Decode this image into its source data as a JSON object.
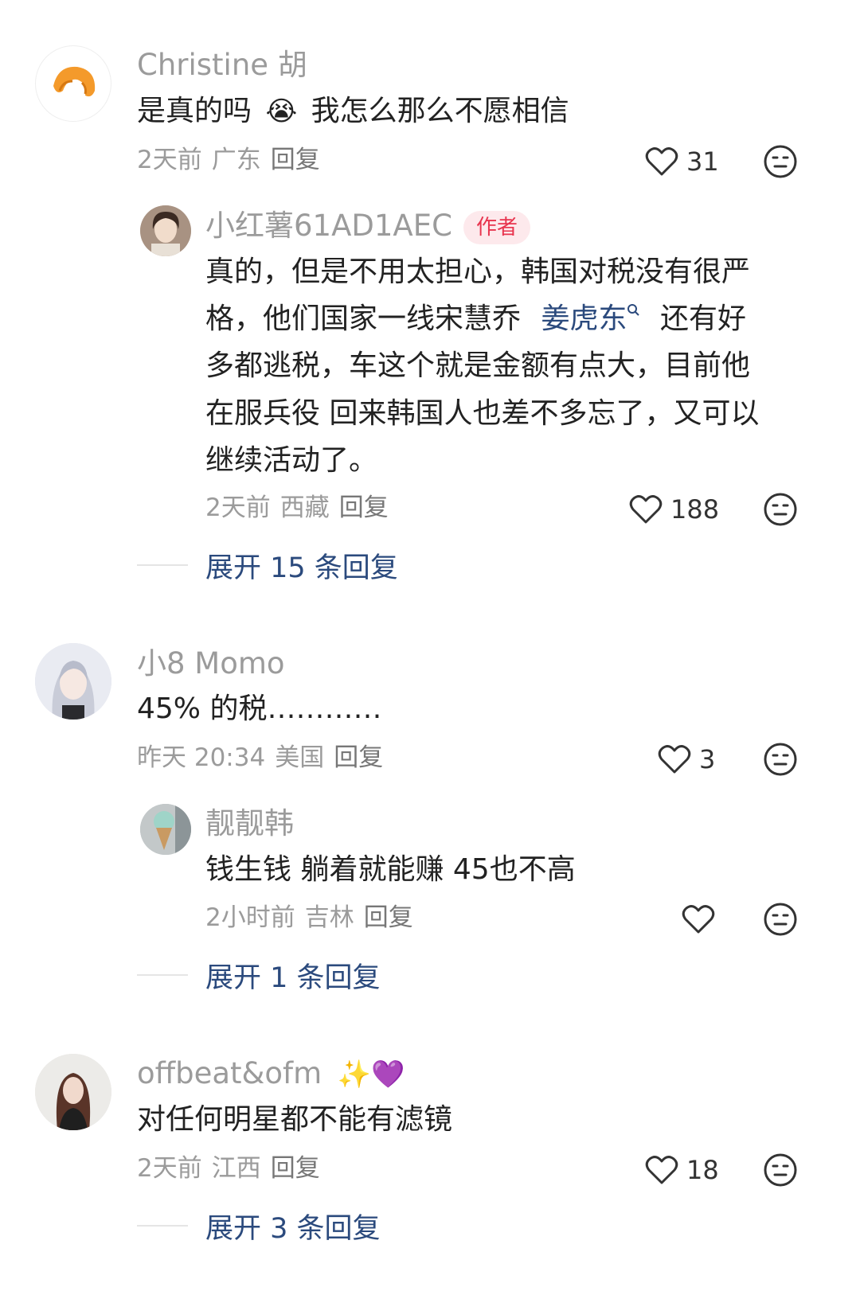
{
  "comments": [
    {
      "author": "Christine 胡",
      "text_before": "是真的吗",
      "emoji": "😭",
      "text_after": "我怎么那么不愿相信",
      "meta": {
        "time": "2天前",
        "location": "广东",
        "reply": "回复"
      },
      "likes": "31",
      "reply": {
        "author": "小红薯61AD1AEC",
        "badge": "作者",
        "lines": [
          "真的，但是不用太担心，韩国对税没有很严",
          "格，他们国家一线宋慧乔",
          "多都逃税，车这个就是金额有点大，目前他",
          "在服兵役 回来韩国人也差不多忘了，又可以",
          "继续活动了。"
        ],
        "link": "姜虎东",
        "link_after": "还有好",
        "meta": {
          "time": "2天前",
          "location": "西藏",
          "reply": "回复"
        },
        "likes": "188"
      },
      "expand": "展开 15 条回复"
    },
    {
      "author": "小8 Momo",
      "text": "45% 的税…………",
      "meta": {
        "time": "昨天 20:34",
        "location": "美国",
        "reply": "回复"
      },
      "likes": "3",
      "reply": {
        "author": "靓靓韩",
        "text": "钱生钱 躺着就能赚 45也不高",
        "meta": {
          "time": "2小时前",
          "location": "吉林",
          "reply": "回复"
        },
        "likes": ""
      },
      "expand": "展开 1 条回复"
    },
    {
      "author": "offbeat&ofm",
      "author_emoji": "✨💜",
      "text": "对任何明星都不能有滤镜",
      "meta": {
        "time": "2天前",
        "location": "江西",
        "reply": "回复"
      },
      "likes": "18",
      "expand": "展开 3 条回复"
    }
  ],
  "icons": {
    "like": "heart-outline-icon",
    "dislike": "meh-face-icon"
  },
  "colors": {
    "name": "#9b9b9b",
    "link": "#2b4a7d",
    "badge_text": "#e8344e",
    "badge_bg": "#fde9ec"
  }
}
